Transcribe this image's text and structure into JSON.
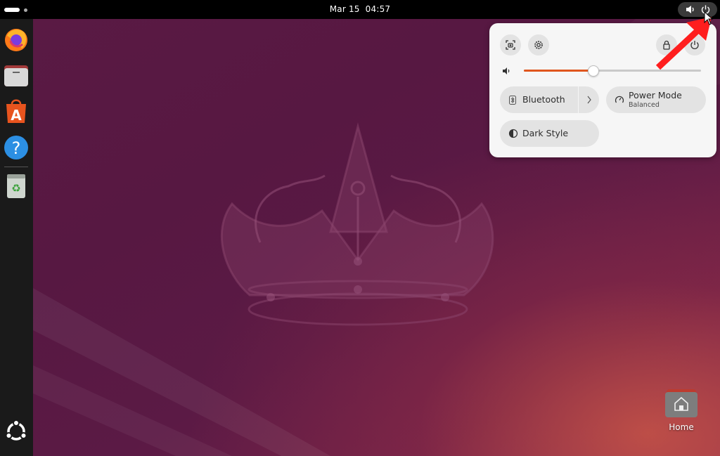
{
  "topbar": {
    "clock": "Mar 15  04:57",
    "activities_label": "Activities"
  },
  "dock": {
    "items": [
      {
        "name": "firefox",
        "icon": "firefox-icon"
      },
      {
        "name": "files",
        "icon": "folder-icon"
      },
      {
        "name": "app-center",
        "icon": "app-center-icon"
      },
      {
        "name": "help",
        "icon": "help-icon"
      },
      {
        "name": "trash",
        "icon": "trash-icon"
      },
      {
        "name": "show-apps",
        "icon": "ubuntu-logo-icon"
      }
    ]
  },
  "quick_settings": {
    "volume": {
      "level": 0.39
    },
    "bluetooth": {
      "label": "Bluetooth"
    },
    "power_mode": {
      "label": "Power Mode",
      "value": "Balanced"
    },
    "dark_style": {
      "label": "Dark Style"
    }
  },
  "desktop": {
    "home_label": "Home"
  },
  "colors": {
    "accent": "#e0561e",
    "annotation_arrow": "#ff1e1e",
    "wallpaper": "#5a1a44"
  }
}
